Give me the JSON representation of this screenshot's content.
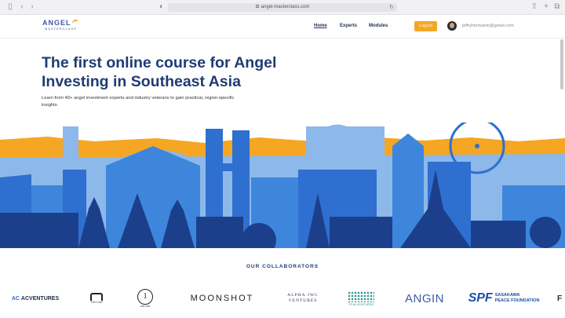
{
  "browser": {
    "url": "angel-masterclass.com",
    "sidebar_icon": "sidebar-icon",
    "back_icon": "chevron-left-icon",
    "forward_icon": "chevron-right-icon",
    "share_icon": "share-icon",
    "new_tab_icon": "plus-icon",
    "tabs_icon": "tabs-icon"
  },
  "header": {
    "logo_main": "ANGEL",
    "logo_sub": "MASTERCLASS",
    "nav": [
      "Home",
      "Experts",
      "Modules"
    ],
    "active_nav": "Home",
    "login_label": "Logout",
    "user_email": "jeffryhermanto@gmail.com"
  },
  "hero": {
    "title": "The first online course for Angel Investing in Southeast Asia",
    "subtitle": "Learn from 40+ angel investment experts and industry veterans to gain practical, region-specific insights."
  },
  "collaborators": {
    "title": "OUR COLLABORATORS",
    "partners": [
      {
        "prefix": "AC",
        "name": "ACVENTURES"
      },
      {
        "name": "TOH LAO"
      },
      {
        "name": "1",
        "caption": "one one"
      },
      {
        "name": "MOONSHOT"
      },
      {
        "line1": "ALPHA JWC",
        "line2": "VENTURES"
      },
      {
        "name": "TEJA VENTURES"
      },
      {
        "name": "ANGIN"
      },
      {
        "mark": "SPF",
        "line1": "SASAKAWA",
        "line2": "PEACE",
        "line3": "FOUNDATION"
      },
      {
        "name": "F"
      }
    ]
  },
  "colors": {
    "brand_blue": "#1f3c74",
    "accent_orange": "#f5a623",
    "skyline_dark": "#1c3f8c",
    "skyline_mid": "#2f6fcf",
    "skyline_light": "#8db8ea"
  }
}
